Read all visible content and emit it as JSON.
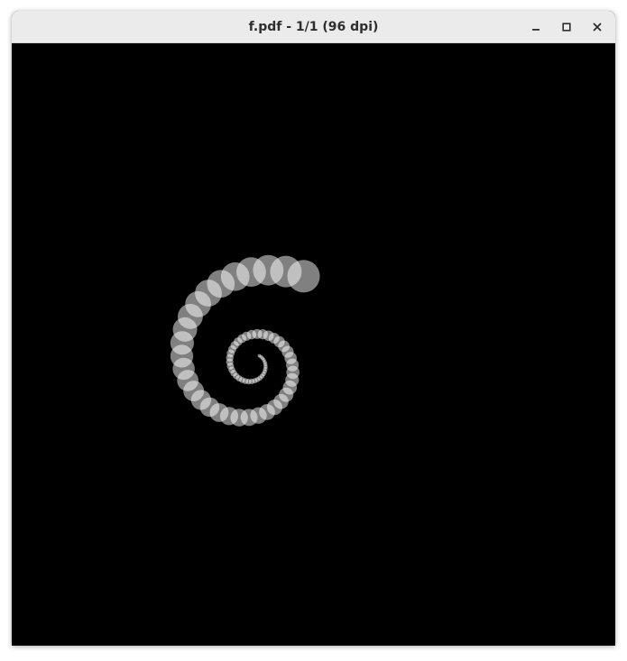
{
  "window": {
    "title": "f.pdf - 1/1 (96 dpi)",
    "controls": [
      {
        "name": "minimize",
        "icon": "minimize-icon"
      },
      {
        "name": "maximize",
        "icon": "maximize-icon"
      },
      {
        "name": "close",
        "icon": "close-icon"
      }
    ]
  },
  "document": {
    "background": "#000000",
    "circle_fill": "#ffffff",
    "circle_opacity": 0.5,
    "circle_count": 70
  }
}
